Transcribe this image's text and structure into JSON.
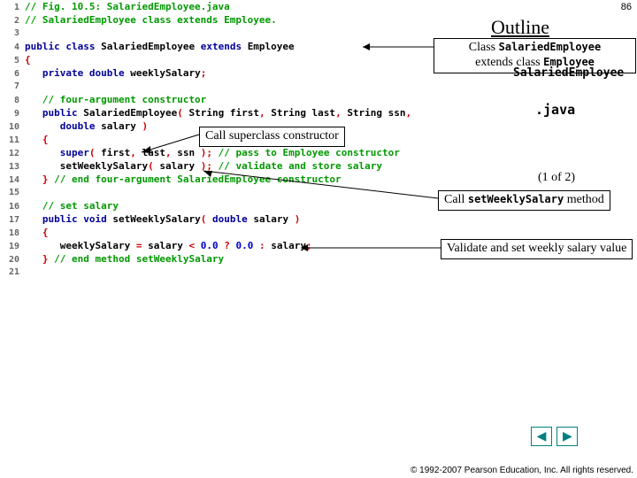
{
  "page_number": "86",
  "outline": "Outline",
  "code": {
    "lines": [
      {
        "n": "1",
        "html": "<span class='c-comment'>// Fig. 10.5: SalariedEmployee.java</span>"
      },
      {
        "n": "2",
        "html": "<span class='c-comment'>// SalariedEmployee class extends Employee.</span>"
      },
      {
        "n": "3",
        "html": ""
      },
      {
        "n": "4",
        "html": "<span class='c-kw'>public class</span> <span class='c-id'>SalariedEmployee</span> <span class='c-kw'>extends</span> <span class='c-id'>Employee</span>"
      },
      {
        "n": "5",
        "html": "<span class='c-punc'>{</span>"
      },
      {
        "n": "6",
        "html": "   <span class='c-kw'>private double</span> <span class='c-id'>weeklySalary</span><span class='c-punc'>;</span>"
      },
      {
        "n": "7",
        "html": ""
      },
      {
        "n": "8",
        "html": "   <span class='c-comment'>// four-argument constructor</span>"
      },
      {
        "n": "9",
        "html": "   <span class='c-kw'>public</span> <span class='c-id'>SalariedEmployee</span><span class='c-punc'>(</span> <span class='c-id'>String first</span><span class='c-punc'>,</span> <span class='c-id'>String last</span><span class='c-punc'>,</span> <span class='c-id'>String ssn</span><span class='c-punc'>,</span>"
      },
      {
        "n": "10",
        "html": "      <span class='c-kw'>double</span> <span class='c-id'>salary</span> <span class='c-punc'>)</span>"
      },
      {
        "n": "11",
        "html": "   <span class='c-punc'>{</span>"
      },
      {
        "n": "12",
        "html": "      <span class='c-kw'>super</span><span class='c-punc'>(</span> <span class='c-id'>first</span><span class='c-punc'>,</span> <span class='c-id'>last</span><span class='c-punc'>,</span> <span class='c-id'>ssn</span> <span class='c-punc'>);</span> <span class='c-comment'>// pass to Employee constructor</span>"
      },
      {
        "n": "13",
        "html": "      <span class='c-id'>setWeeklySalary</span><span class='c-punc'>(</span> <span class='c-id'>salary</span> <span class='c-punc'>);</span> <span class='c-comment'>// validate and store salary</span>"
      },
      {
        "n": "14",
        "html": "   <span class='c-punc'>}</span> <span class='c-comment'>// end four-argument SalariedEmployee constructor</span>"
      },
      {
        "n": "15",
        "html": ""
      },
      {
        "n": "16",
        "html": "   <span class='c-comment'>// set salary</span>"
      },
      {
        "n": "17",
        "html": "   <span class='c-kw'>public void</span> <span class='c-id'>setWeeklySalary</span><span class='c-punc'>(</span> <span class='c-kw'>double</span> <span class='c-id'>salary</span> <span class='c-punc'>)</span>"
      },
      {
        "n": "18",
        "html": "   <span class='c-punc'>{</span>"
      },
      {
        "n": "19",
        "html": "      <span class='c-id'>weeklySalary</span> <span class='c-punc'>=</span> <span class='c-id'>salary</span> <span class='c-punc'>&lt;</span> <span class='c-num'>0.0</span> <span class='c-punc'>?</span> <span class='c-num'>0.0</span> <span class='c-punc'>:</span> <span class='c-id'>salary</span><span class='c-punc'>;</span>"
      },
      {
        "n": "20",
        "html": "   <span class='c-punc'>}</span> <span class='c-comment'>// end method setWeeklySalary</span>"
      },
      {
        "n": "21",
        "html": ""
      }
    ]
  },
  "callouts": {
    "extends": {
      "pre": "Class ",
      "mono1": "SalariedEmployee",
      "mid": " extends class ",
      "mono2": "Employee"
    },
    "super": "Call superclass constructor",
    "setws": {
      "pre": "Call ",
      "mono": "setWeeklySalary",
      "post": " method"
    },
    "validate": "Validate and set weekly salary value"
  },
  "filename_label": "SalariedEmployee",
  "ext_label": ".java",
  "paging": "(1 of  2)",
  "nav": {
    "prev": "◀",
    "next": "▶"
  },
  "copyright": "© 1992-2007 Pearson Education, Inc.  All rights reserved."
}
